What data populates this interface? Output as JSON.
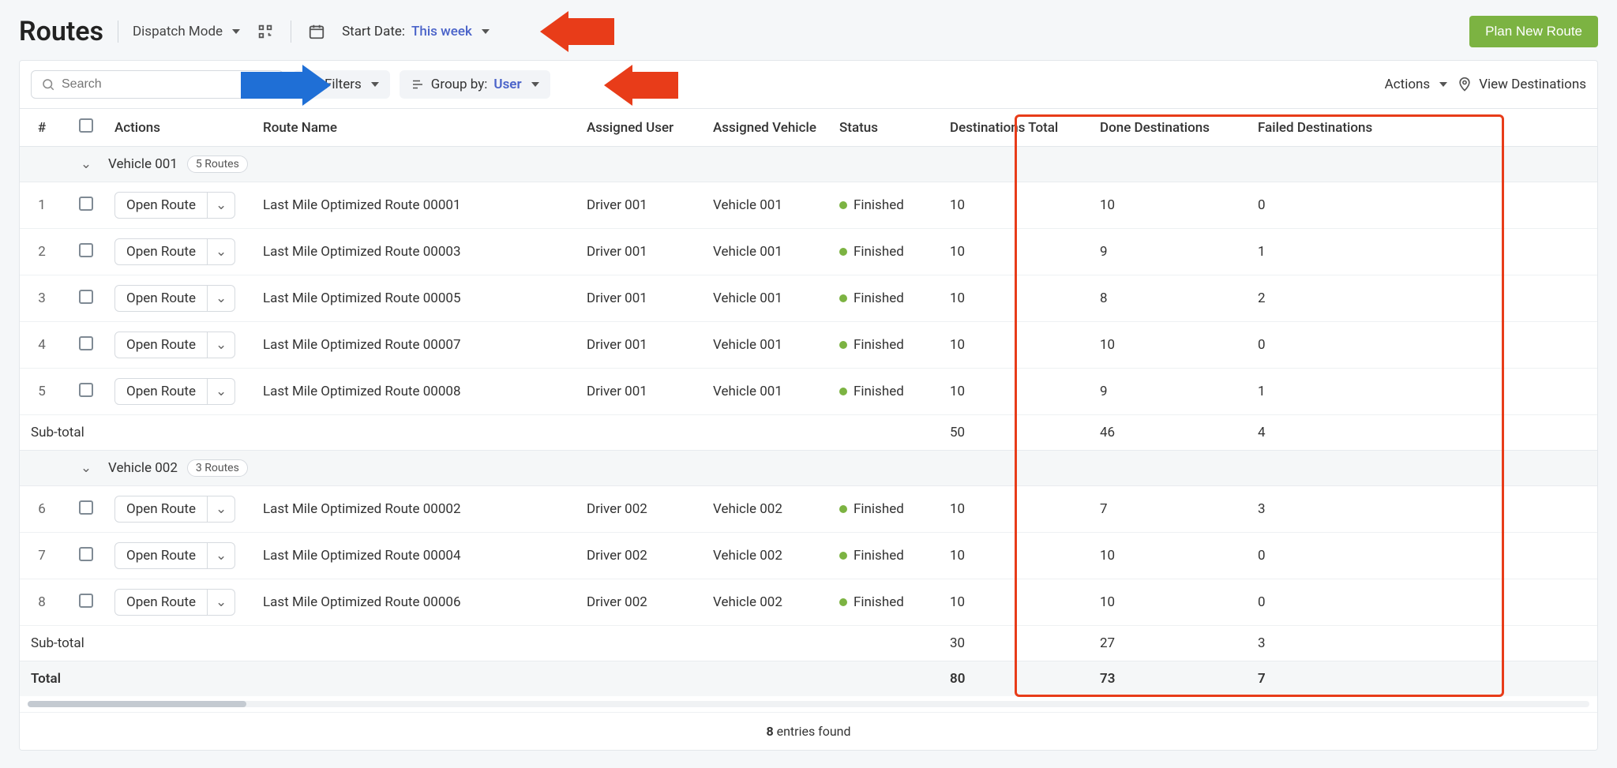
{
  "header": {
    "title": "Routes",
    "dispatch_mode_label": "Dispatch Mode",
    "start_date_label": "Start Date:",
    "start_date_value": "This week",
    "plan_button": "Plan New Route"
  },
  "toolbar": {
    "search_placeholder": "Search",
    "filters_label": "Filters",
    "group_by_label": "Group by:",
    "group_by_value": "User",
    "actions_label": "Actions",
    "view_destinations_label": "View Destinations"
  },
  "columns": {
    "hash": "#",
    "actions": "Actions",
    "route_name": "Route Name",
    "assigned_user": "Assigned User",
    "assigned_vehicle": "Assigned Vehicle",
    "status": "Status",
    "dest_total": "Destinations Total",
    "done_dest": "Done Destinations",
    "failed_dest": "Failed Destinations"
  },
  "buttons": {
    "open_route": "Open Route"
  },
  "groups": [
    {
      "name": "Vehicle 001",
      "badge": "5 Routes",
      "rows": [
        {
          "n": "1",
          "route": "Last Mile Optimized Route 00001",
          "user": "Driver 001",
          "vehicle": "Vehicle 001",
          "status": "Finished",
          "total": "10",
          "done": "10",
          "failed": "0"
        },
        {
          "n": "2",
          "route": "Last Mile Optimized Route 00003",
          "user": "Driver 001",
          "vehicle": "Vehicle 001",
          "status": "Finished",
          "total": "10",
          "done": "9",
          "failed": "1"
        },
        {
          "n": "3",
          "route": "Last Mile Optimized Route 00005",
          "user": "Driver 001",
          "vehicle": "Vehicle 001",
          "status": "Finished",
          "total": "10",
          "done": "8",
          "failed": "2"
        },
        {
          "n": "4",
          "route": "Last Mile Optimized Route 00007",
          "user": "Driver 001",
          "vehicle": "Vehicle 001",
          "status": "Finished",
          "total": "10",
          "done": "10",
          "failed": "0"
        },
        {
          "n": "5",
          "route": "Last Mile Optimized Route 00008",
          "user": "Driver 001",
          "vehicle": "Vehicle 001",
          "status": "Finished",
          "total": "10",
          "done": "9",
          "failed": "1"
        }
      ],
      "subtotal": {
        "label": "Sub-total",
        "total": "50",
        "done": "46",
        "failed": "4"
      }
    },
    {
      "name": "Vehicle 002",
      "badge": "3 Routes",
      "rows": [
        {
          "n": "6",
          "route": "Last Mile Optimized Route 00002",
          "user": "Driver 002",
          "vehicle": "Vehicle 002",
          "status": "Finished",
          "total": "10",
          "done": "7",
          "failed": "3"
        },
        {
          "n": "7",
          "route": "Last Mile Optimized Route 00004",
          "user": "Driver 002",
          "vehicle": "Vehicle 002",
          "status": "Finished",
          "total": "10",
          "done": "10",
          "failed": "0"
        },
        {
          "n": "8",
          "route": "Last Mile Optimized Route 00006",
          "user": "Driver 002",
          "vehicle": "Vehicle 002",
          "status": "Finished",
          "total": "10",
          "done": "10",
          "failed": "0"
        }
      ],
      "subtotal": {
        "label": "Sub-total",
        "total": "30",
        "done": "27",
        "failed": "3"
      }
    }
  ],
  "total_row": {
    "label": "Total",
    "total": "80",
    "done": "73",
    "failed": "7"
  },
  "footer": {
    "count": "8",
    "text": "entries found"
  }
}
